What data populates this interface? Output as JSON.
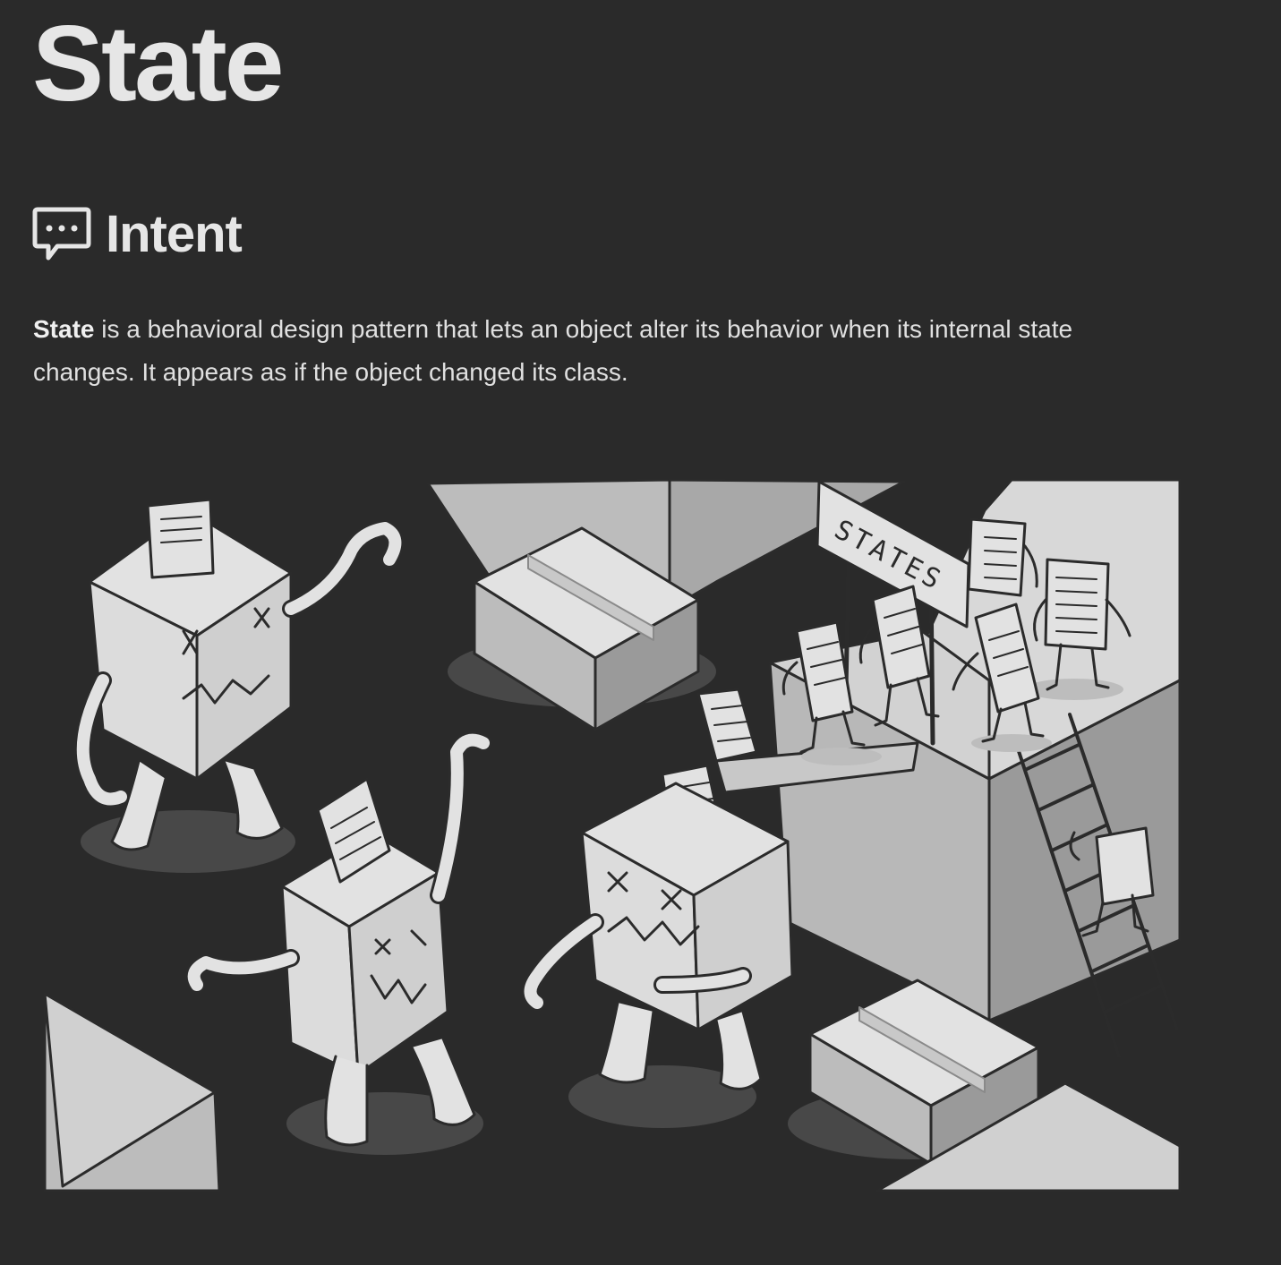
{
  "page": {
    "title": "State"
  },
  "intent": {
    "heading": "Intent",
    "icon": "speech-bubble-icon",
    "subject": "State",
    "text": " is a behavioral design pattern that lets an object alter its behavior when its internal state changes. It appears as if the object changed its class."
  },
  "illustration": {
    "sign_text": "STATES",
    "colors": {
      "background": "#2a2a2a",
      "outline": "#2b2b2b",
      "fill_light": "#e2e2e2",
      "fill_mid": "#bcbcbc",
      "fill_dark": "#9a9a9a",
      "shadow": "#484848"
    }
  }
}
